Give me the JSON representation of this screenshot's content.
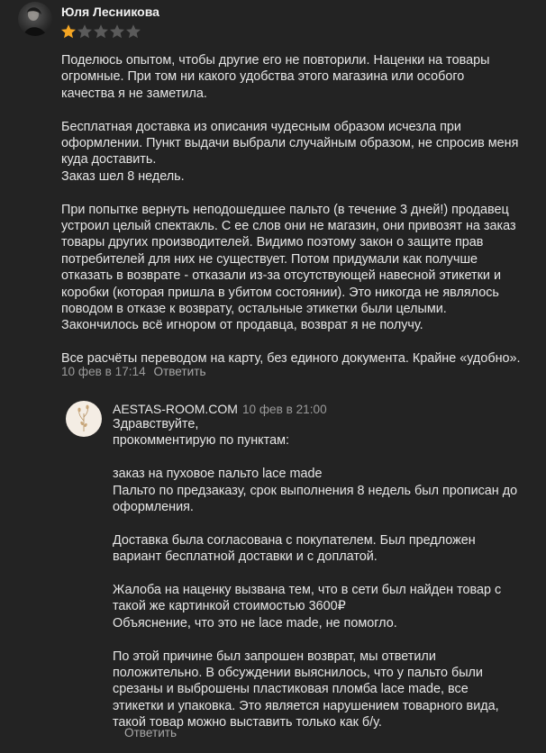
{
  "review": {
    "author": "Юля Лесникова",
    "rating": 1,
    "rating_max": 5,
    "colors": {
      "star_filled": "#f5a623",
      "star_empty": "#5a5a5a",
      "background": "#232323"
    },
    "paragraphs": [
      "Поделюсь опытом, чтобы другие его не повторили. Наценки на товары\nогромные. При том ни какого удобства этого магазина или особого\nкачества я не заметила.",
      "Бесплатная доставка из описания чудесным образом исчезла при\nоформлении. Пункт выдачи выбрали случайным образом, не спросив меня\nкуда доставить.\nЗаказ шел 8 недель.",
      "При попытке вернуть неподошедшее пальто (в течение 3 дней!) продавец\nустроил целый спектакль. С ее слов они не магазин, они привозят на заказ\nтовары других производителей. Видимо поэтому закон о защите прав\nпотребителей для них не существует. Потом придумали как получше\nотказать в возврате - отказали из-за отсутствующей навесной этикетки и\nкоробки (которая пришла в убитом состоянии). Это никогда не являлось\nповодом в отказе к возврату, остальные этикетки были целыми.\nЗакончилось всё игнором от продавца, возврат я не получу.",
      "Все расчёты переводом на карту, без единого документа. Крайне «удобно»."
    ],
    "date": "10 фев в 17:14",
    "reply_label": "Ответить"
  },
  "answer": {
    "seller": "AESTAS-ROOM.COM",
    "date": "10 фев в 21:00",
    "paragraphs": [
      "Здравствуйте,\nпрокомментирую по пунктам:",
      "заказ на пуховое пальто lace made\nПальто по предзаказу, срок выполнения 8 недель был прописан до\nоформления.",
      "Доставка была согласована с покупателем. Был предложен\nвариант бесплатной доставки и с доплатой.",
      "Жалоба на наценку вызвана тем, что в сети был найден товар с\nтакой же картинкой стоимостью 3600₽\nОбъяснение, что это не lace made, не помогло.",
      "По этой причине был запрошен возврат, мы ответили\nположительно. В обсуждении выяснилось, что у пальто были\nсрезаны и выброшены пластиковая пломба lace made, все\nэтикетки и упаковка. Это является нарушением товарного вида,\nтакой товар можно выставить только как б/у."
    ],
    "reply_label": "Ответить"
  }
}
